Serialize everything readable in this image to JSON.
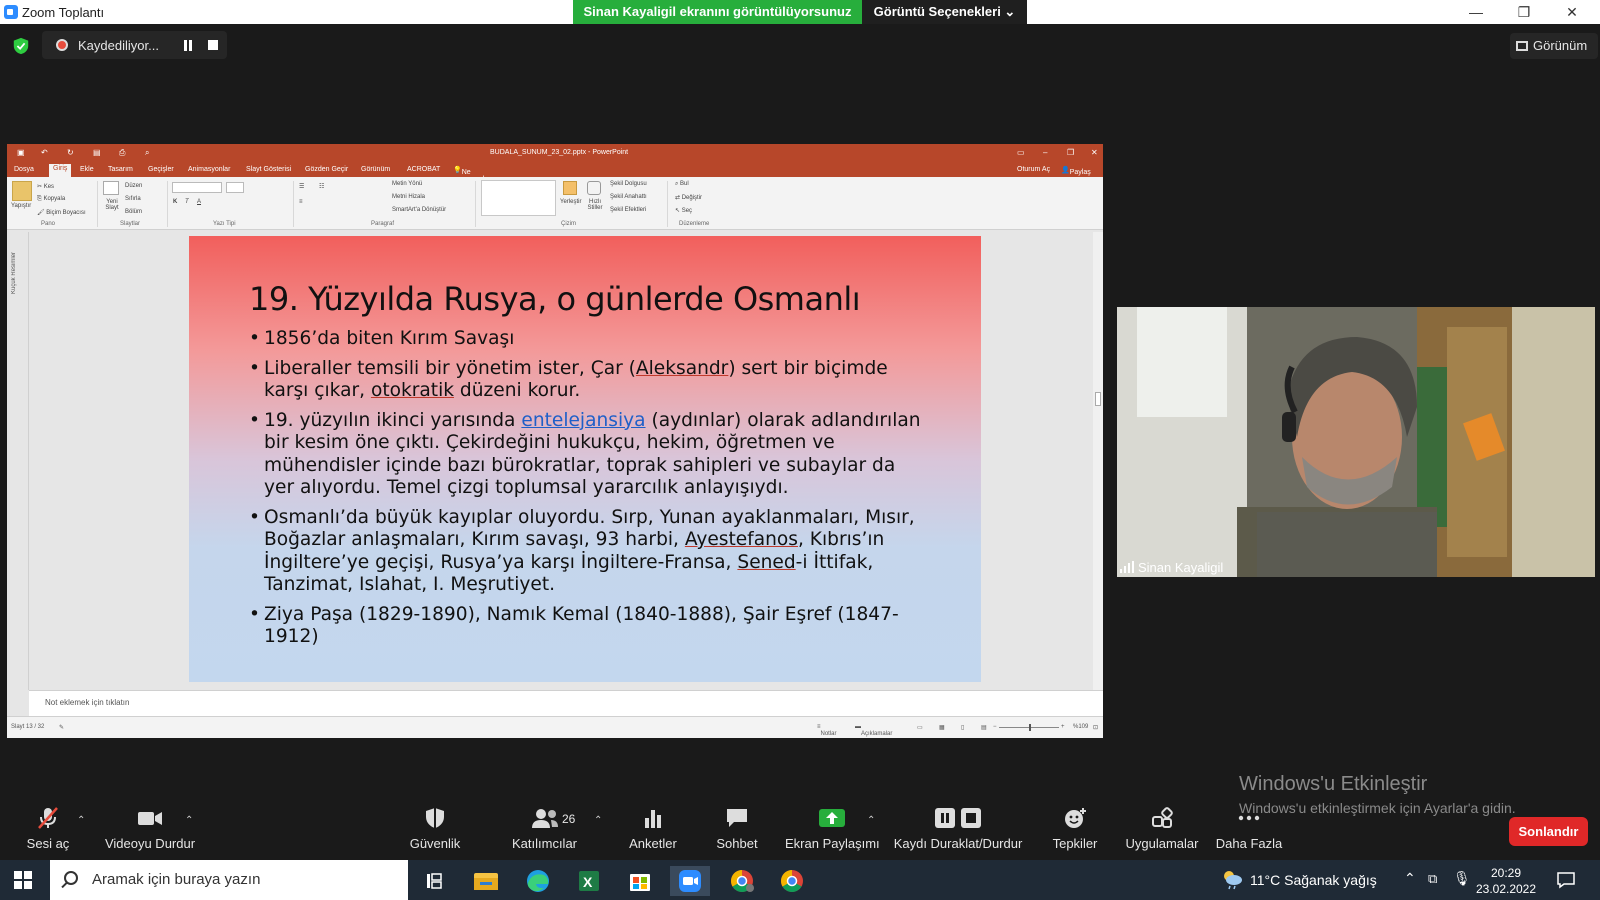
{
  "window": {
    "title": "Zoom Toplantı",
    "minimize": "—",
    "restore": "❐",
    "close": "✕"
  },
  "share_banner": "Sinan Kayaligil ekranını görüntülüyorsunuz",
  "view_options": "Görüntü Seçenekleri ⌄",
  "recording": {
    "label": "Kaydediliyor..."
  },
  "view_button": "Görünüm",
  "powerpoint": {
    "filename": "BUDALA_SUNUM_23_02.pptx - PowerPoint",
    "tabs": [
      "Dosya",
      "Giriş",
      "Ekle",
      "Tasarım",
      "Geçişler",
      "Animasyonlar",
      "Slayt Gösterisi",
      "Gözden Geçir",
      "Görünüm",
      "ACROBAT"
    ],
    "tell_me": "Ne yapmak istediğinizi söyleyin...",
    "sign_in": "Oturum Aç",
    "share": "Paylaş",
    "ribbon": {
      "pano": {
        "label": "Pano",
        "paste": "Yapıştır",
        "cut": "Kes",
        "copy": "Kopyala",
        "format_painter": "Biçim Boyacısı"
      },
      "slaytlar": {
        "label": "Slaytlar",
        "new_slide": "Yeni Slayt",
        "layout": "Düzen",
        "reset": "Sıfırla",
        "section": "Bölüm"
      },
      "yazi_tipi": {
        "label": "Yazı Tipi"
      },
      "paragraf": {
        "label": "Paragraf",
        "text_direction": "Metin Yönü",
        "align_text": "Metni Hizala",
        "smartart": "SmartArt'a Dönüştür"
      },
      "cizim": {
        "label": "Çizim",
        "arrange": "Yerleştir",
        "quick_styles": "Hızlı Stiller",
        "fill": "Şekil Dolgusu",
        "outline": "Şekil Anahattı",
        "effects": "Şekil Efektleri"
      },
      "duzenleme": {
        "label": "Düzenleme",
        "find": "Bul",
        "replace": "Değiştir",
        "select": "Seç"
      }
    },
    "thumbnail_pane_label": "Küçük Resimler",
    "notes_placeholder": "Not eklemek için tıklatın",
    "status": {
      "slide": "Slayt 13 / 32",
      "notes": "Notlar",
      "comments": "Açıklamalar",
      "zoom": "%109"
    },
    "slide": {
      "title": "19. Yüzyılda Rusya, o günlerde Osmanlı",
      "bullets": [
        {
          "parts": [
            "1856’da biten Kırım Savaşı"
          ]
        },
        {
          "parts": [
            "Liberaller temsili bir yönetim ister, Çar (",
            "Aleksandr",
            ") sert bir biçimde karşı çıkar, ",
            "otokratik",
            " düzeni korur."
          ]
        },
        {
          "parts": [
            "19. yüzyılın ikinci yarısında ",
            "entelejansiya",
            " (aydınlar) olarak adlandırılan bir kesim öne çıktı. Çekirdeğini hukukçu, hekim, öğretmen ve mühendisler içinde bazı bürokratlar, toprak sahipleri ve subaylar da yer alıyordu. Temel çizgi toplumsal yararcılık anlayışıydı."
          ]
        },
        {
          "parts": [
            "Osmanlı’da büyük kayıplar oluyordu. Sırp, Yunan ayaklanmaları, Mısır, Boğazlar anlaşmaları, Kırım savaşı, 93 harbi, ",
            "Ayestefanos",
            ", Kıbrıs’ın İngiltere’ye geçişi, Rusya’ya karşı İngiltere-Fransa, ",
            "Sened",
            "-i İttifak, Tanzimat, Islahat, I. Meşrutiyet."
          ]
        },
        {
          "parts": [
            "Ziya Paşa (1829-1890), Namık Kemal (1840-1888), Şair Eşref (1847-1912)"
          ]
        }
      ]
    }
  },
  "participant": {
    "name": "Sinan Kayaligil"
  },
  "activation": {
    "title": "Windows'u Etkinleştir",
    "subtitle": "Windows'u etkinleştirmek için Ayarlar'a gidin."
  },
  "controls": {
    "unmute": "Sesi aç",
    "stop_video": "Videoyu Durdur",
    "security": "Güvenlik",
    "participants": "Katılımcılar",
    "participants_count": "26",
    "polls": "Anketler",
    "chat": "Sohbet",
    "share_screen": "Ekran Paylaşımı",
    "pause_stop_recording": "Kaydı Duraklat/Durdur",
    "reactions": "Tepkiler",
    "apps": "Uygulamalar",
    "more": "Daha Fazla",
    "end": "Sonlandır"
  },
  "taskbar": {
    "search_placeholder": "Aramak için buraya yazın",
    "weather": "11°C  Sağanak yağış",
    "time": "20:29",
    "date": "23.02.2022"
  },
  "colors": {
    "share_green": "#27ae3c",
    "ppt_red": "#b7472a",
    "end_red": "#e02828",
    "link_blue": "#1f5fc8"
  }
}
